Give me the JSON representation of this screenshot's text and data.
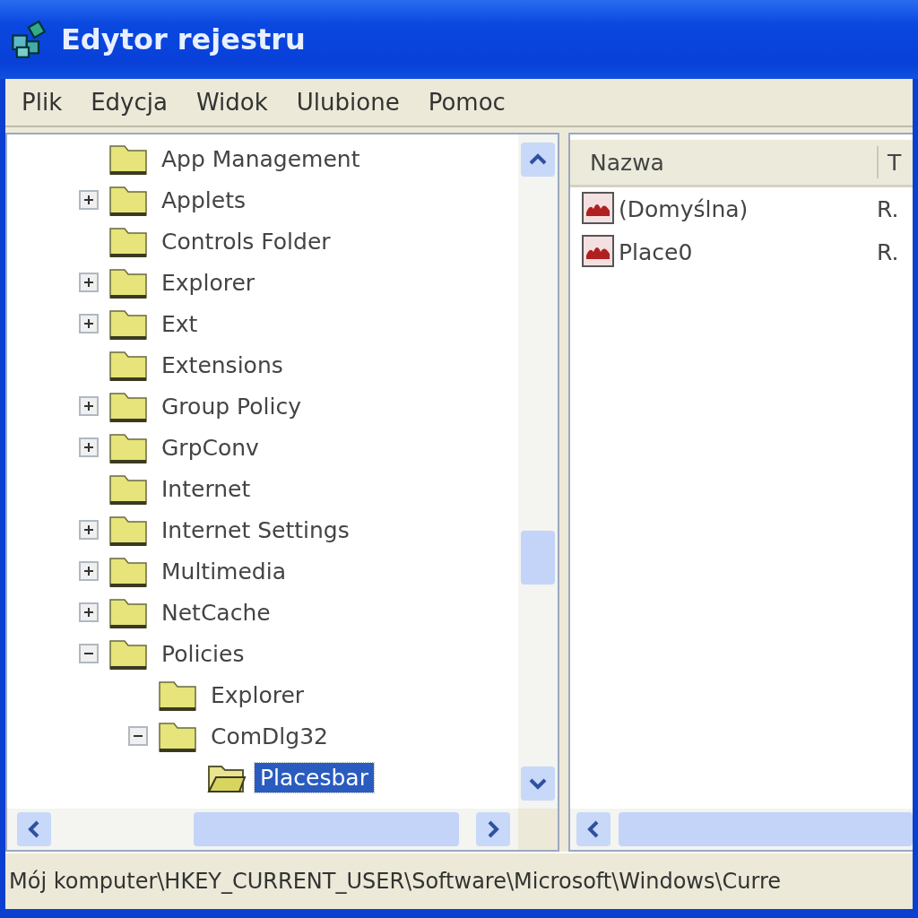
{
  "window": {
    "title": "Edytor rejestru"
  },
  "menu": [
    "Plik",
    "Edycja",
    "Widok",
    "Ulubione",
    "Pomoc"
  ],
  "tree": [
    {
      "label": "App Management",
      "selected": false
    },
    {
      "label": "Applets",
      "expanded": false,
      "selected": false
    },
    {
      "label": "Controls Folder",
      "selected": false
    },
    {
      "label": "Explorer",
      "expanded": false,
      "selected": false
    },
    {
      "label": "Ext",
      "expanded": false,
      "selected": false
    },
    {
      "label": "Extensions",
      "selected": false
    },
    {
      "label": "Group Policy",
      "expanded": false,
      "selected": false
    },
    {
      "label": "GrpConv",
      "expanded": false,
      "selected": false
    },
    {
      "label": "Internet",
      "selected": false
    },
    {
      "label": "Internet Settings",
      "expanded": false,
      "selected": false
    },
    {
      "label": "Multimedia",
      "expanded": false,
      "selected": false
    },
    {
      "label": "NetCache",
      "expanded": false,
      "selected": false
    },
    {
      "label": "Policies",
      "expanded": true,
      "selected": false,
      "children": [
        {
          "label": "Explorer",
          "selected": false
        },
        {
          "label": "ComDlg32",
          "expanded": true,
          "selected": false,
          "children": [
            {
              "label": "Placesbar",
              "selected": true
            }
          ]
        }
      ]
    }
  ],
  "list": {
    "columns": [
      "Nazwa",
      "T"
    ],
    "rows": [
      {
        "name": "(Domyślna)",
        "column_2": "R."
      },
      {
        "name": "Place0",
        "column_2": "R."
      }
    ]
  },
  "status_bar": "Mój komputer\\HKEY_CURRENT_USER\\Software\\Microsoft\\Windows\\Curre"
}
